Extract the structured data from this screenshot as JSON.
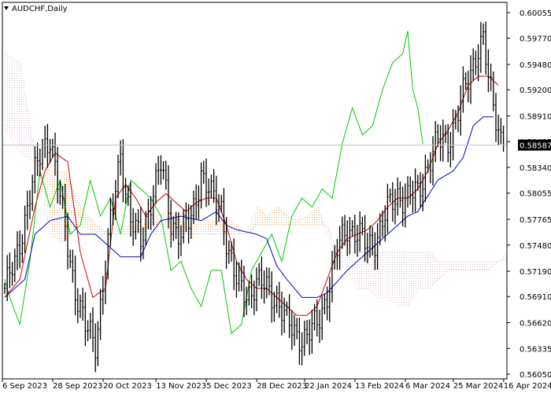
{
  "window": {
    "title": "AUDCHF,Daily",
    "menu_icon": "triangle-down-icon"
  },
  "colors": {
    "background": "#ffffff",
    "frame": "#000000",
    "bar": "#000000",
    "price_line": "#c0c0c0",
    "current_price_label_bg": "#000000",
    "current_price_label_text": "#ffffff",
    "tenkan": "#cc0000",
    "kijun": "#0000cc",
    "chikou": "#00cc00",
    "kumo_up": "#f4a460",
    "kumo_down": "#d8bfd8"
  },
  "chart_data": {
    "type": "candlestick",
    "symbol": "AUDCHF",
    "timeframe": "Daily",
    "ylim": [
      0.5605,
      0.60055
    ],
    "y_ticks": [
      0.60055,
      0.5977,
      0.5948,
      0.592,
      0.5891,
      0.58625,
      0.5834,
      0.58055,
      0.57765,
      0.5748,
      0.5719,
      0.5691,
      0.5662,
      0.56335,
      0.5605
    ],
    "y_tick_labels": [
      "0.60055",
      "0.59770",
      "0.59480",
      "0.59200",
      "0.58910",
      "0.58625",
      "0.58340",
      "0.58055",
      "0.57765",
      "0.57480",
      "0.57190",
      "0.56910",
      "0.56620",
      "0.56335",
      "0.56050"
    ],
    "current_price": 0.58587,
    "current_price_label": "0.58587",
    "x_labels": [
      "6 Sep 2023",
      "28 Sep 2023",
      "20 Oct 2023",
      "13 Nov 2023",
      "5 Dec 2023",
      "28 Dec 2023",
      "22 Jan 2024",
      "13 Feb 2024",
      "6 Mar 2024",
      "25 Mar 2024",
      "16 Apr 2024"
    ],
    "close_anchors": [
      [
        0,
        0.57
      ],
      [
        4,
        0.5725
      ],
      [
        10,
        0.5805
      ],
      [
        15,
        0.5855
      ],
      [
        18,
        0.587
      ],
      [
        23,
        0.578
      ],
      [
        28,
        0.57
      ],
      [
        32,
        0.5655
      ],
      [
        36,
        0.564
      ],
      [
        42,
        0.577
      ],
      [
        46,
        0.585
      ],
      [
        50,
        0.5775
      ],
      [
        54,
        0.575
      ],
      [
        58,
        0.58
      ],
      [
        62,
        0.5835
      ],
      [
        66,
        0.5775
      ],
      [
        70,
        0.576
      ],
      [
        74,
        0.5775
      ],
      [
        78,
        0.583
      ],
      [
        82,
        0.58
      ],
      [
        86,
        0.579
      ],
      [
        89,
        0.574
      ],
      [
        92,
        0.5705
      ],
      [
        96,
        0.5695
      ],
      [
        100,
        0.5705
      ],
      [
        104,
        0.57
      ],
      [
        108,
        0.569
      ],
      [
        112,
        0.566
      ],
      [
        116,
        0.565
      ],
      [
        120,
        0.5645
      ],
      [
        124,
        0.566
      ],
      [
        128,
        0.5695
      ],
      [
        132,
        0.574
      ],
      [
        136,
        0.577
      ],
      [
        140,
        0.576
      ],
      [
        144,
        0.5745
      ],
      [
        148,
        0.576
      ],
      [
        152,
        0.5785
      ],
      [
        156,
        0.5805
      ],
      [
        160,
        0.58
      ],
      [
        164,
        0.5805
      ],
      [
        168,
        0.584
      ],
      [
        172,
        0.586
      ],
      [
        176,
        0.5865
      ],
      [
        180,
        0.5895
      ],
      [
        184,
        0.593
      ],
      [
        188,
        0.597
      ],
      [
        190,
        0.5975
      ],
      [
        192,
        0.593
      ],
      [
        194,
        0.59
      ],
      [
        196,
        0.588
      ],
      [
        198,
        0.5859
      ]
    ],
    "tenkan_anchors": [
      [
        0,
        0.569
      ],
      [
        6,
        0.571
      ],
      [
        12,
        0.579
      ],
      [
        16,
        0.583
      ],
      [
        20,
        0.585
      ],
      [
        25,
        0.584
      ],
      [
        30,
        0.574
      ],
      [
        35,
        0.569
      ],
      [
        40,
        0.57
      ],
      [
        44,
        0.58
      ],
      [
        48,
        0.5815
      ],
      [
        52,
        0.58
      ],
      [
        56,
        0.578
      ],
      [
        60,
        0.5795
      ],
      [
        64,
        0.5805
      ],
      [
        68,
        0.5795
      ],
      [
        72,
        0.5785
      ],
      [
        76,
        0.5795
      ],
      [
        80,
        0.58
      ],
      [
        84,
        0.58
      ],
      [
        88,
        0.577
      ],
      [
        92,
        0.573
      ],
      [
        96,
        0.571
      ],
      [
        100,
        0.57
      ],
      [
        104,
        0.57
      ],
      [
        108,
        0.569
      ],
      [
        112,
        0.568
      ],
      [
        116,
        0.567
      ],
      [
        120,
        0.567
      ],
      [
        124,
        0.568
      ],
      [
        128,
        0.571
      ],
      [
        132,
        0.574
      ],
      [
        136,
        0.5755
      ],
      [
        140,
        0.576
      ],
      [
        144,
        0.5765
      ],
      [
        148,
        0.5775
      ],
      [
        152,
        0.579
      ],
      [
        156,
        0.58
      ],
      [
        160,
        0.58
      ],
      [
        164,
        0.581
      ],
      [
        168,
        0.583
      ],
      [
        172,
        0.586
      ],
      [
        176,
        0.5875
      ],
      [
        180,
        0.5895
      ],
      [
        184,
        0.5925
      ],
      [
        188,
        0.5935
      ],
      [
        192,
        0.5935
      ],
      [
        196,
        0.5925
      ]
    ],
    "kijun_anchors": [
      [
        0,
        0.569
      ],
      [
        8,
        0.571
      ],
      [
        12,
        0.576
      ],
      [
        18,
        0.5775
      ],
      [
        25,
        0.578
      ],
      [
        30,
        0.576
      ],
      [
        36,
        0.576
      ],
      [
        40,
        0.575
      ],
      [
        46,
        0.5735
      ],
      [
        54,
        0.5735
      ],
      [
        58,
        0.576
      ],
      [
        62,
        0.5775
      ],
      [
        70,
        0.578
      ],
      [
        78,
        0.5775
      ],
      [
        84,
        0.5785
      ],
      [
        88,
        0.577
      ],
      [
        92,
        0.5765
      ],
      [
        100,
        0.576
      ],
      [
        104,
        0.5755
      ],
      [
        108,
        0.5725
      ],
      [
        112,
        0.571
      ],
      [
        118,
        0.569
      ],
      [
        124,
        0.569
      ],
      [
        128,
        0.5695
      ],
      [
        136,
        0.572
      ],
      [
        144,
        0.574
      ],
      [
        150,
        0.5755
      ],
      [
        154,
        0.5765
      ],
      [
        160,
        0.578
      ],
      [
        164,
        0.5785
      ],
      [
        172,
        0.582
      ],
      [
        178,
        0.583
      ],
      [
        182,
        0.5845
      ],
      [
        186,
        0.588
      ],
      [
        190,
        0.589
      ],
      [
        194,
        0.589
      ]
    ],
    "chikou_anchors": [
      [
        0,
        0.571
      ],
      [
        2,
        0.569
      ],
      [
        6,
        0.566
      ],
      [
        10,
        0.573
      ],
      [
        14,
        0.583
      ],
      [
        18,
        0.579
      ],
      [
        22,
        0.582
      ],
      [
        26,
        0.576
      ],
      [
        30,
        0.577
      ],
      [
        34,
        0.582
      ],
      [
        38,
        0.578
      ],
      [
        42,
        0.58
      ],
      [
        46,
        0.576
      ],
      [
        50,
        0.582
      ],
      [
        54,
        0.581
      ],
      [
        58,
        0.58
      ],
      [
        62,
        0.578
      ],
      [
        66,
        0.572
      ],
      [
        70,
        0.573
      ],
      [
        74,
        0.57
      ],
      [
        78,
        0.568
      ],
      [
        82,
        0.572
      ],
      [
        86,
        0.572
      ],
      [
        90,
        0.565
      ],
      [
        94,
        0.566
      ],
      [
        98,
        0.572
      ],
      [
        102,
        0.574
      ],
      [
        106,
        0.576
      ],
      [
        110,
        0.573
      ],
      [
        114,
        0.578
      ],
      [
        118,
        0.58
      ],
      [
        122,
        0.579
      ],
      [
        126,
        0.581
      ],
      [
        130,
        0.58
      ],
      [
        134,
        0.586
      ],
      [
        138,
        0.59
      ],
      [
        142,
        0.587
      ],
      [
        146,
        0.588
      ],
      [
        150,
        0.592
      ],
      [
        154,
        0.595
      ],
      [
        158,
        0.596
      ],
      [
        160,
        0.5985
      ],
      [
        162,
        0.592
      ],
      [
        164,
        0.59
      ],
      [
        166,
        0.586
      ]
    ],
    "senkou_a_anchors": [
      [
        0,
        0.588
      ],
      [
        6,
        0.585
      ],
      [
        12,
        0.584
      ],
      [
        18,
        0.583
      ],
      [
        24,
        0.583
      ],
      [
        30,
        0.579
      ],
      [
        36,
        0.577
      ],
      [
        42,
        0.576
      ],
      [
        48,
        0.577
      ],
      [
        54,
        0.577
      ],
      [
        60,
        0.578
      ],
      [
        66,
        0.5785
      ],
      [
        72,
        0.577
      ],
      [
        78,
        0.5775
      ],
      [
        84,
        0.5775
      ],
      [
        90,
        0.5775
      ],
      [
        96,
        0.576
      ],
      [
        100,
        0.579
      ],
      [
        104,
        0.578
      ],
      [
        108,
        0.579
      ],
      [
        112,
        0.578
      ],
      [
        116,
        0.5775
      ],
      [
        120,
        0.578
      ],
      [
        124,
        0.579
      ],
      [
        128,
        0.576
      ],
      [
        132,
        0.573
      ],
      [
        136,
        0.572
      ],
      [
        140,
        0.57
      ],
      [
        144,
        0.57
      ],
      [
        148,
        0.569
      ],
      [
        152,
        0.569
      ],
      [
        156,
        0.568
      ],
      [
        160,
        0.568
      ],
      [
        164,
        0.57
      ],
      [
        168,
        0.57
      ],
      [
        172,
        0.571
      ],
      [
        176,
        0.572
      ],
      [
        180,
        0.572
      ],
      [
        184,
        0.572
      ],
      [
        188,
        0.572
      ],
      [
        192,
        0.572
      ],
      [
        196,
        0.573
      ],
      [
        200,
        0.574
      ],
      [
        204,
        0.575
      ],
      [
        208,
        0.576
      ],
      [
        212,
        0.577
      ]
    ],
    "senkou_b_anchors": [
      [
        0,
        0.596
      ],
      [
        6,
        0.595
      ],
      [
        10,
        0.588
      ],
      [
        14,
        0.582
      ],
      [
        18,
        0.576
      ],
      [
        22,
        0.575
      ],
      [
        26,
        0.576
      ],
      [
        30,
        0.577
      ],
      [
        36,
        0.576
      ],
      [
        42,
        0.576
      ],
      [
        48,
        0.576
      ],
      [
        54,
        0.576
      ],
      [
        60,
        0.576
      ],
      [
        66,
        0.576
      ],
      [
        72,
        0.576
      ],
      [
        78,
        0.576
      ],
      [
        84,
        0.576
      ],
      [
        90,
        0.576
      ],
      [
        96,
        0.576
      ],
      [
        100,
        0.577
      ],
      [
        104,
        0.577
      ],
      [
        108,
        0.577
      ],
      [
        112,
        0.577
      ],
      [
        116,
        0.577
      ],
      [
        120,
        0.577
      ],
      [
        124,
        0.577
      ],
      [
        128,
        0.577
      ],
      [
        132,
        0.574
      ],
      [
        136,
        0.574
      ],
      [
        140,
        0.574
      ],
      [
        144,
        0.574
      ],
      [
        148,
        0.574
      ],
      [
        152,
        0.574
      ],
      [
        156,
        0.574
      ],
      [
        160,
        0.574
      ],
      [
        164,
        0.574
      ],
      [
        168,
        0.574
      ],
      [
        172,
        0.573
      ],
      [
        176,
        0.573
      ],
      [
        180,
        0.573
      ],
      [
        184,
        0.573
      ],
      [
        188,
        0.573
      ],
      [
        192,
        0.573
      ],
      [
        196,
        0.573
      ],
      [
        200,
        0.573
      ],
      [
        204,
        0.573
      ],
      [
        208,
        0.573
      ],
      [
        212,
        0.573
      ]
    ]
  }
}
